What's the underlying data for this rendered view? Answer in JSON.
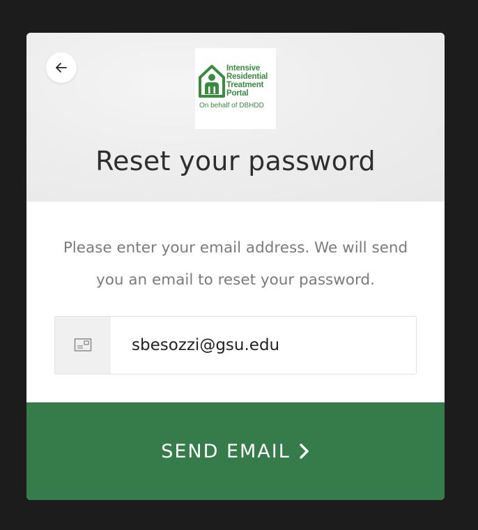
{
  "header": {
    "back_button_icon": "arrow-left-icon",
    "logo": {
      "lines": [
        "Intensive",
        "Residential",
        "Treatment",
        "Portal"
      ],
      "subtitle": "On behalf of DBHDD",
      "icon": "house-person-icon",
      "color": "#3a8a3f"
    },
    "title": "Reset your password"
  },
  "body": {
    "instructions": "Please enter your email address. We will send you an email to reset your password.",
    "email_field": {
      "icon": "envelope-icon",
      "value": "sbesozzi@gsu.edu"
    }
  },
  "footer": {
    "send_label": "SEND EMAIL",
    "send_icon": "chevron-right-icon",
    "button_color": "#367c4a"
  }
}
